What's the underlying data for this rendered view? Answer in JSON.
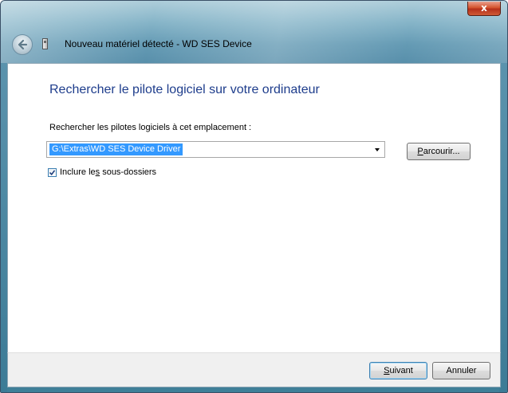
{
  "window": {
    "title": "Nouveau matériel détecté - WD SES Device",
    "close_label": "x"
  },
  "content": {
    "heading": "Rechercher le pilote logiciel sur votre ordinateur",
    "location_label": "Rechercher les pilotes logiciels à cet emplacement :",
    "location_value": "G:\\Extras\\WD SES Device Driver",
    "browse": {
      "underlined": "P",
      "rest": "arcourir..."
    },
    "include_subfolders": {
      "checked": true,
      "before": "Inclure le",
      "underlined": "s",
      "after": " sous-dossiers"
    }
  },
  "footer": {
    "next": {
      "underlined": "S",
      "rest": "uivant"
    },
    "cancel_label": "Annuler"
  }
}
